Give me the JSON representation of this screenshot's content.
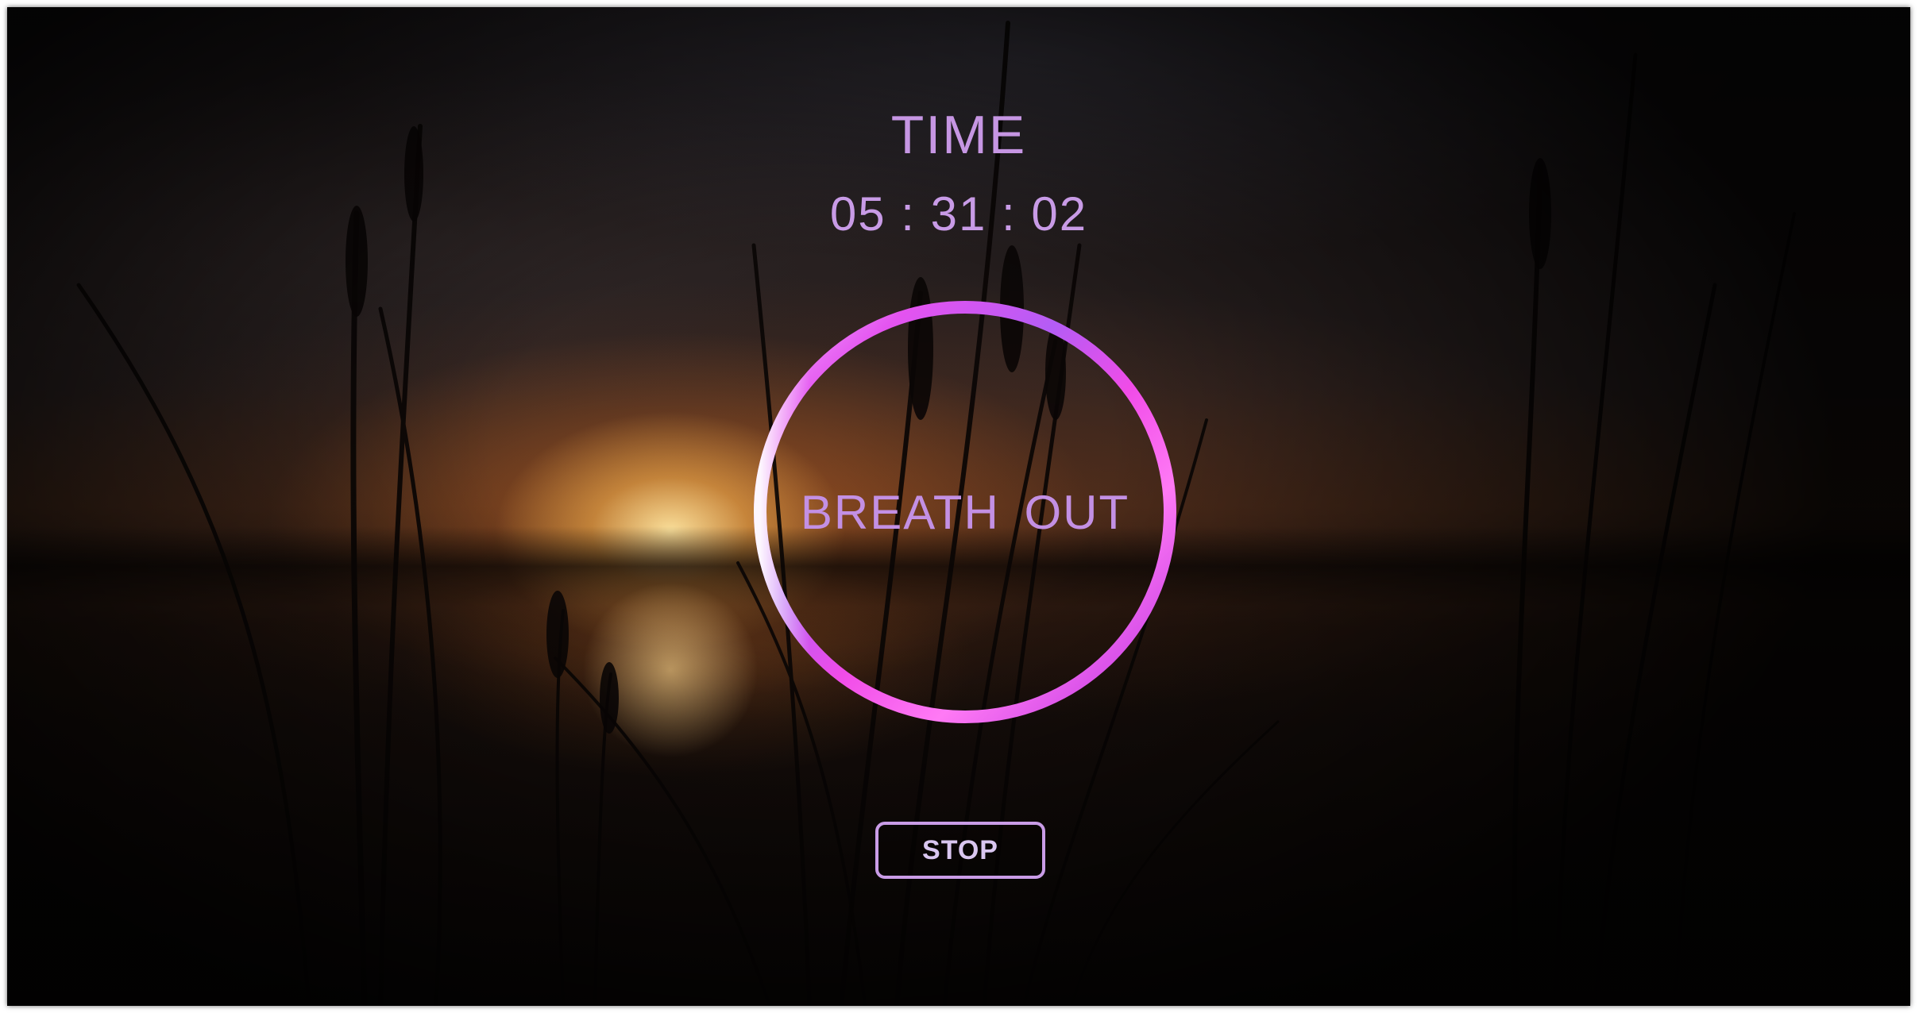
{
  "timer": {
    "label": "TIME",
    "value": "05 : 31 : 02"
  },
  "breath_circle": {
    "instruction": "BREATH  OUT",
    "ring_colors": [
      "#b45cf5",
      "#f04ce8",
      "#ffffff",
      "#ff7af5"
    ]
  },
  "controls": {
    "stop_label": "STOP"
  },
  "theme": {
    "accent": "#c696e3",
    "button_border": "#c99ce7",
    "background_scene": "sunset-over-lake-with-reeds"
  }
}
